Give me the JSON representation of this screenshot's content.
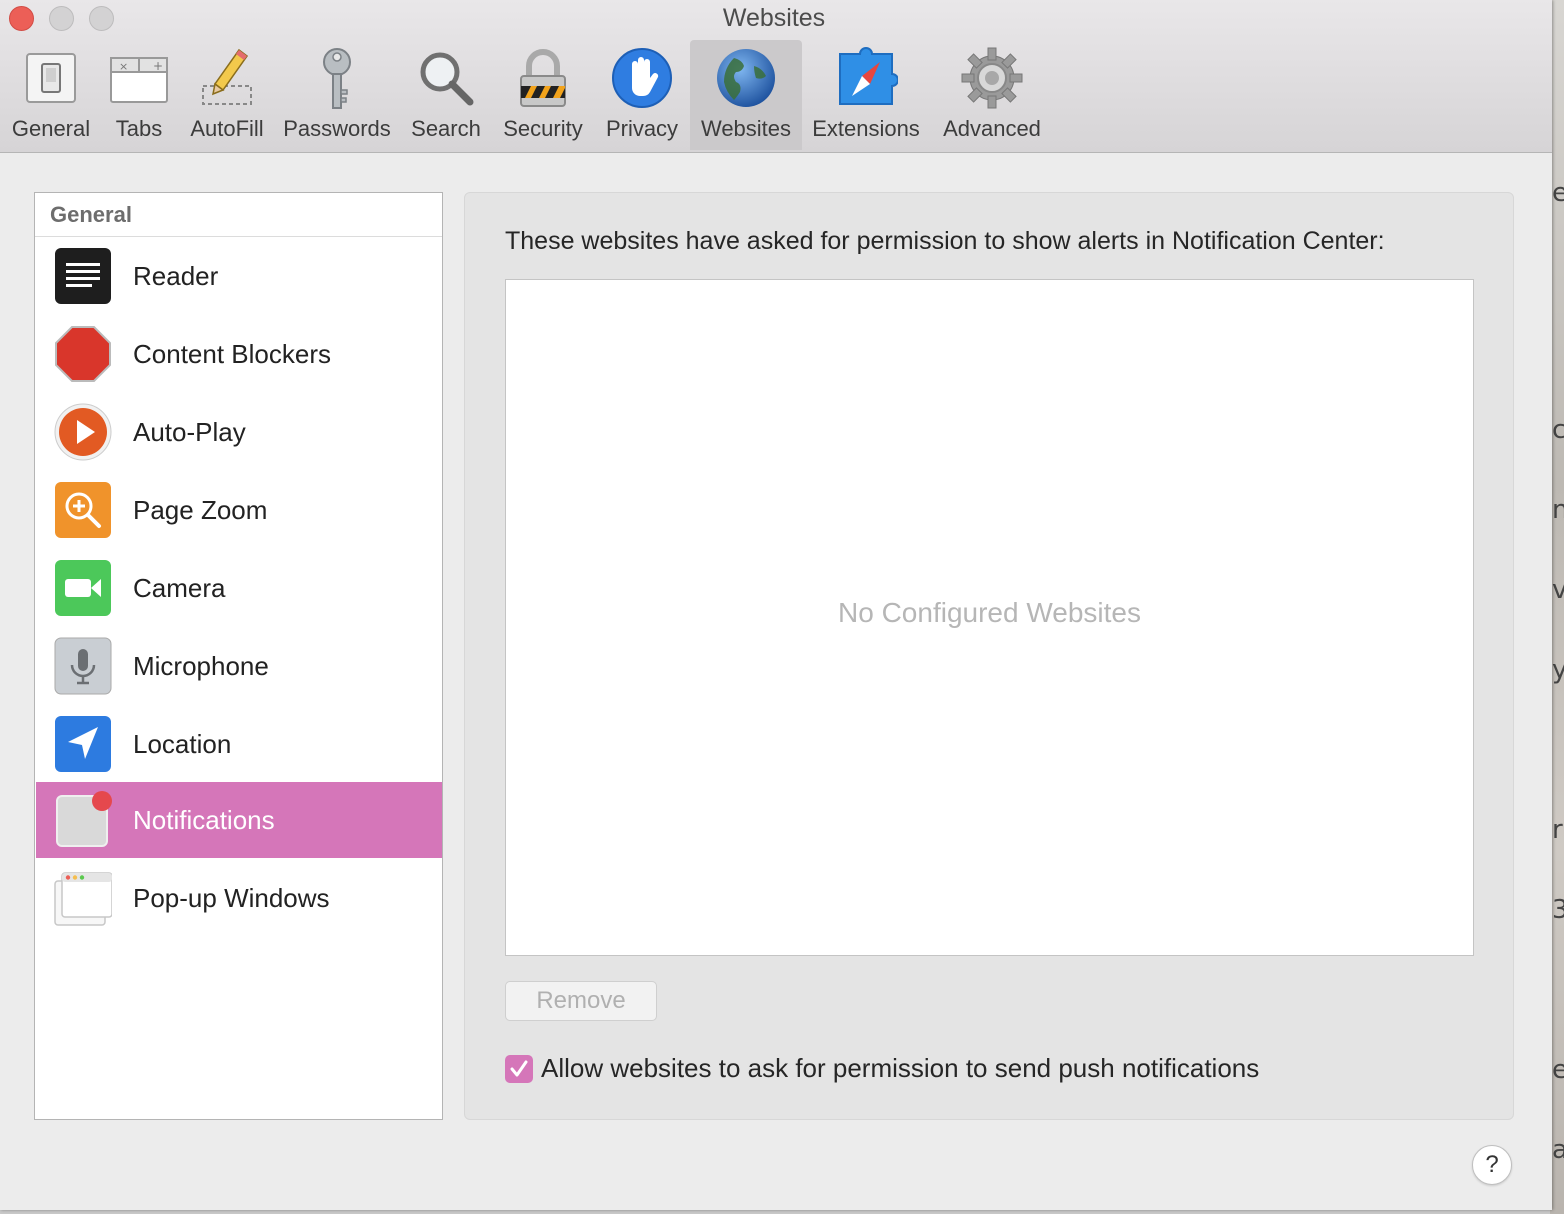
{
  "window": {
    "title": "Websites"
  },
  "toolbar": {
    "items": [
      {
        "label": "General",
        "icon": "general-switch-icon"
      },
      {
        "label": "Tabs",
        "icon": "tabs-icon"
      },
      {
        "label": "AutoFill",
        "icon": "autofill-pencil-icon"
      },
      {
        "label": "Passwords",
        "icon": "key-icon"
      },
      {
        "label": "Search",
        "icon": "magnifier-icon"
      },
      {
        "label": "Security",
        "icon": "padlock-icon"
      },
      {
        "label": "Privacy",
        "icon": "hand-icon"
      },
      {
        "label": "Websites",
        "icon": "globe-icon",
        "selected": true
      },
      {
        "label": "Extensions",
        "icon": "puzzle-compass-icon"
      },
      {
        "label": "Advanced",
        "icon": "gear-icon"
      }
    ]
  },
  "sidebar": {
    "header": "General",
    "items": [
      {
        "label": "Reader",
        "icon": "reader-icon"
      },
      {
        "label": "Content Blockers",
        "icon": "stop-sign-icon"
      },
      {
        "label": "Auto-Play",
        "icon": "play-icon"
      },
      {
        "label": "Page Zoom",
        "icon": "zoom-icon"
      },
      {
        "label": "Camera",
        "icon": "camera-icon"
      },
      {
        "label": "Microphone",
        "icon": "microphone-icon"
      },
      {
        "label": "Location",
        "icon": "location-arrow-icon"
      },
      {
        "label": "Notifications",
        "icon": "notification-badge-icon",
        "selected": true
      },
      {
        "label": "Pop-up Windows",
        "icon": "popup-window-icon"
      }
    ]
  },
  "main": {
    "description": "These websites have asked for permission to show alerts in Notification Center:",
    "empty_text": "No Configured Websites",
    "remove_label": "Remove",
    "checkbox_label": "Allow websites to ask for permission to send push notifications",
    "checkbox_checked": true
  },
  "help_label": "?",
  "colors": {
    "accent": "#d576b9",
    "close": "#ec5f57"
  }
}
